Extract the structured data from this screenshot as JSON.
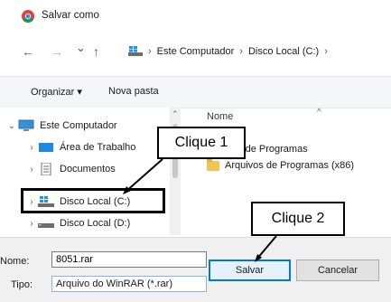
{
  "window": {
    "title": "Salvar como",
    "app_icon": "chrome-icon"
  },
  "nav": {
    "back_icon": "←",
    "forward_icon": "→",
    "history_icon": "⌄",
    "up_icon": "↑",
    "breadcrumbs": [
      "Este Computador",
      "Disco Local (C:)"
    ],
    "separator": "›"
  },
  "toolbar": {
    "organize_label": "Organizar ▾",
    "new_folder_label": "Nova pasta"
  },
  "tree": {
    "items": [
      {
        "label": "Este Computador",
        "icon": "computer-icon",
        "expanded": true
      },
      {
        "label": "Área de Trabalho",
        "icon": "desktop-icon"
      },
      {
        "label": "Documentos",
        "icon": "documents-icon"
      },
      {
        "label": "Disco Local (C:)",
        "icon": "drive-windows-icon",
        "selected": true
      },
      {
        "label": "Disco Local (D:)",
        "icon": "drive-icon"
      }
    ]
  },
  "file_list": {
    "header_partial": "Nome",
    "items": [
      {
        "label": "Arquivos de Programas",
        "visible_text": "ivos de Programas"
      },
      {
        "label": "Arquivos de Programas (x86)"
      }
    ]
  },
  "form": {
    "name_label": "Nome:",
    "name_value": "8051.rar",
    "type_label": "Tipo:",
    "type_value": "Arquivo do WinRAR (*.rar)"
  },
  "buttons": {
    "save_label": "Salvar",
    "cancel_label": "Cancelar"
  },
  "callouts": {
    "first": "Clique 1",
    "second": "Clique 2"
  },
  "colors": {
    "accent": "#0078d7",
    "folder": "#f1c453",
    "toolbar_bg": "#f4f6fa",
    "form_bg": "#f0f0f0"
  }
}
